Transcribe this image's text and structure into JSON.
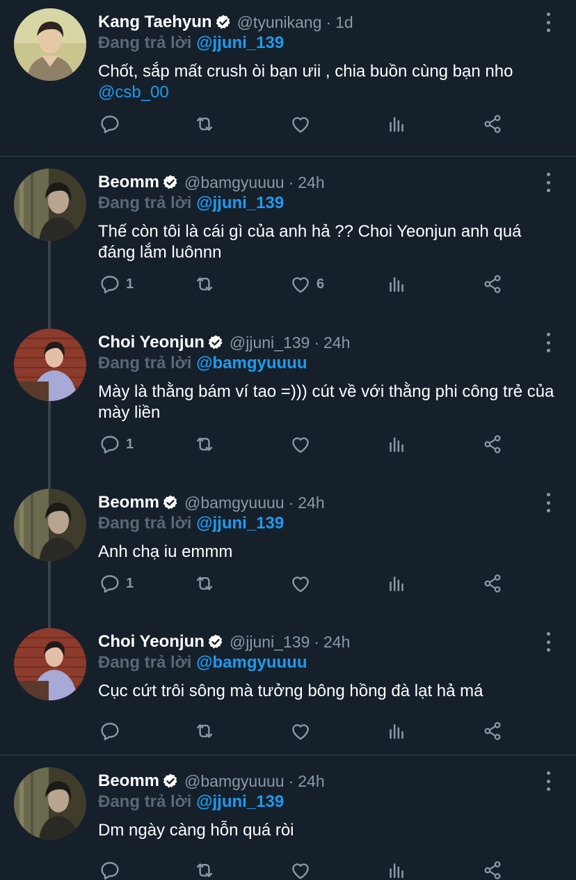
{
  "reply_prefix": "Đang trả lời",
  "colors": {
    "background": "#15202b",
    "accent": "#1d9bf0",
    "muted": "#8b98a5",
    "divider": "#38444d"
  },
  "tweets": [
    {
      "name": "Kang Taehyun",
      "handle": "@tyunikang",
      "time": "1d",
      "reply_to": "@jjuni_139",
      "text": "Chốt, sắp mất crush òi bạn ưii , chia buồn cùng bạn nho ",
      "text_mention": "@csb_00",
      "replies": "",
      "likes": ""
    },
    {
      "name": "Beomm",
      "handle": "@bamgyuuuu",
      "time": "24h",
      "reply_to": "@jjuni_139",
      "text": "Thế còn tôi là cái gì của anh hả ?? Choi Yeonjun anh quá đáng lắm luônnn",
      "text_mention": "",
      "replies": "1",
      "likes": "6"
    },
    {
      "name": "Choi Yeonjun",
      "handle": "@jjuni_139",
      "time": "24h",
      "reply_to": "@bamgyuuuu",
      "text": "Mày là thằng bám ví tao =))) cút về với thằng phi công trẻ của mày liền",
      "text_mention": "",
      "replies": "1",
      "likes": ""
    },
    {
      "name": "Beomm",
      "handle": "@bamgyuuuu",
      "time": "24h",
      "reply_to": "@jjuni_139",
      "text": "Anh chạ iu emmm",
      "text_mention": "",
      "replies": "1",
      "likes": ""
    },
    {
      "name": "Choi Yeonjun",
      "handle": "@jjuni_139",
      "time": "24h",
      "reply_to": "@bamgyuuuu",
      "text": "Cục cứt trôi sông mà tưởng bông hồng đà lạt hả má",
      "text_mention": "",
      "replies": "",
      "likes": ""
    },
    {
      "name": "Beomm",
      "handle": "@bamgyuuuu",
      "time": "24h",
      "reply_to": "@jjuni_139",
      "text": "Dm ngày càng hỗn quá ròi",
      "text_mention": "",
      "replies": "",
      "likes": ""
    }
  ],
  "icons": [
    "verified-badge-icon",
    "more-options-icon",
    "reply-icon",
    "retweet-icon",
    "like-icon",
    "analytics-icon",
    "share-icon"
  ]
}
